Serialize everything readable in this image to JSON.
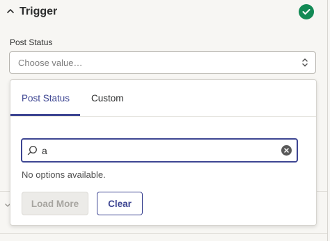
{
  "trigger": {
    "title": "Trigger",
    "status_icon": "check-circle-icon",
    "status_color": "#138a55"
  },
  "field": {
    "label": "Post Status",
    "placeholder": "Choose value…"
  },
  "dropdown": {
    "tabs": [
      {
        "label": "Post Status",
        "active": true
      },
      {
        "label": "Custom",
        "active": false
      }
    ],
    "search": {
      "value": "a"
    },
    "empty_message": "No options available.",
    "load_more_label": "Load More",
    "clear_label": "Clear"
  },
  "colors": {
    "accent": "#3d4592",
    "success": "#138a55"
  }
}
